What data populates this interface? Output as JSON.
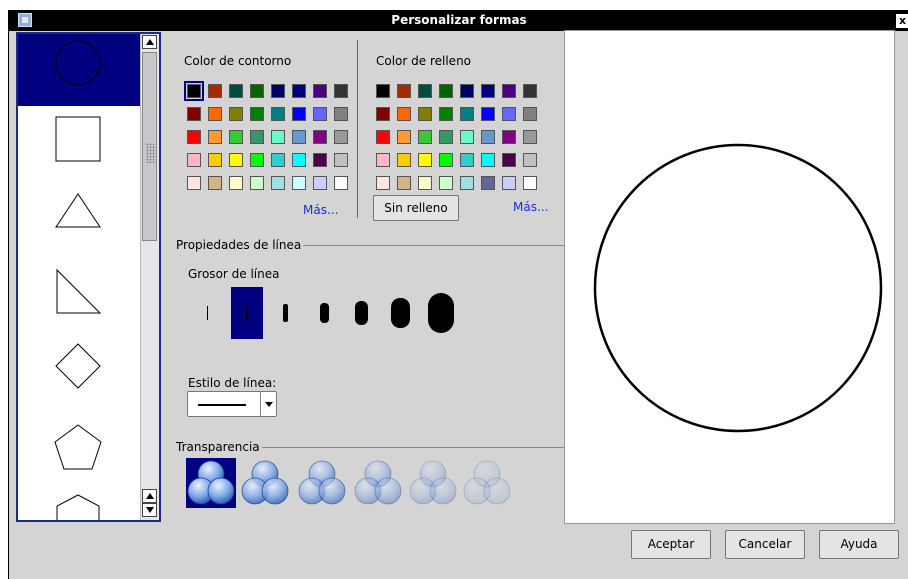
{
  "window": {
    "title": "Personalizar formas",
    "close_label": "x"
  },
  "shapes": [
    "circle",
    "square",
    "triangle",
    "right-triangle",
    "diamond",
    "pentagon",
    "hexagon"
  ],
  "shapes_selected": 0,
  "outline": {
    "label": "Color de contorno",
    "more_label": "Más...",
    "selected": [
      0,
      0
    ],
    "colors": [
      [
        "#000000",
        "#a52a00",
        "#004d40",
        "#006400",
        "#000066",
        "#000080",
        "#4b0082",
        "#333333"
      ],
      [
        "#800000",
        "#ff6600",
        "#808000",
        "#008000",
        "#008080",
        "#0000ff",
        "#6666ff",
        "#808080"
      ],
      [
        "#ff0000",
        "#ff9933",
        "#33cc33",
        "#339966",
        "#66ffcc",
        "#6699cc",
        "#800080",
        "#999999"
      ],
      [
        "#ffb6c1",
        "#ffcc00",
        "#ffff00",
        "#00ff00",
        "#33cccc",
        "#00ffff",
        "#4b0047",
        "#c0c0c0"
      ],
      [
        "#ffe4e1",
        "#d2b48c",
        "#ffffcc",
        "#ccffcc",
        "#a0e0e0",
        "#ccffff",
        "#ccccff",
        "#ffffff"
      ]
    ]
  },
  "fill": {
    "label": "Color de relleno",
    "more_label": "Más...",
    "no_fill_label": "Sin relleno",
    "colors": [
      [
        "#000000",
        "#a52a00",
        "#004d40",
        "#006400",
        "#000066",
        "#000080",
        "#4b0082",
        "#333333"
      ],
      [
        "#800000",
        "#ff6600",
        "#808000",
        "#008000",
        "#008080",
        "#0000ff",
        "#6666ff",
        "#808080"
      ],
      [
        "#ff0000",
        "#ff9933",
        "#33cc33",
        "#339966",
        "#66ffcc",
        "#6699cc",
        "#800080",
        "#999999"
      ],
      [
        "#ffb6c1",
        "#ffcc00",
        "#ffff00",
        "#00ff00",
        "#33cccc",
        "#00ffff",
        "#4b0047",
        "#c0c0c0"
      ],
      [
        "#ffe4e1",
        "#d2b48c",
        "#ffffcc",
        "#ccffcc",
        "#a0e0e0",
        "#666699",
        "#ccccff",
        "#ffffff"
      ]
    ]
  },
  "line_props": {
    "group_label": "Propiedades de línea",
    "thickness_label": "Grosor de línea",
    "thickness_selected": 1,
    "style_label": "Estilo de línea:"
  },
  "transparency": {
    "group_label": "Transparencia",
    "selected": 0,
    "levels": [
      1.0,
      0.8,
      0.6,
      0.4,
      0.25,
      0.12
    ]
  },
  "preview_shape": "circle",
  "buttons": {
    "accept": "Aceptar",
    "cancel": "Cancelar",
    "help": "Ayuda"
  }
}
